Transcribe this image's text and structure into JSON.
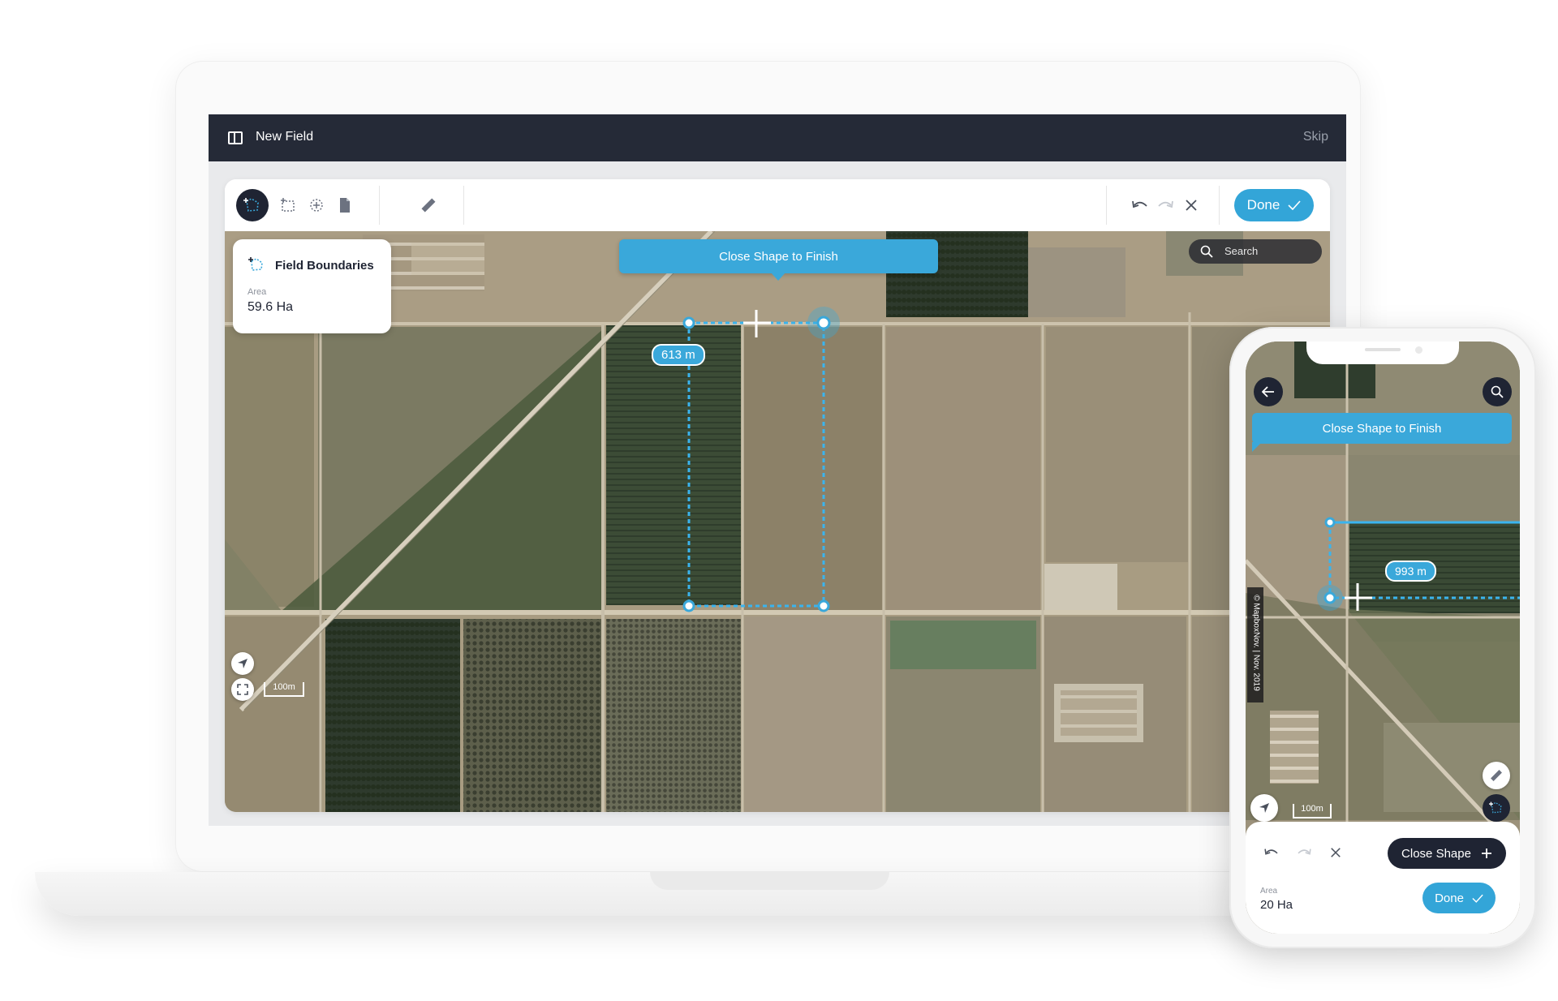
{
  "window": {
    "title": "New Field",
    "skip_label": "Skip"
  },
  "toolbar": {
    "done_label": "Done",
    "tools": [
      "draw-boundary-icon",
      "rectangle-select-icon",
      "add-point-icon",
      "document-icon",
      "ruler-icon"
    ],
    "actions": [
      "undo-icon",
      "redo-icon",
      "close-icon"
    ]
  },
  "field_panel": {
    "title": "Field Boundaries",
    "area_label": "Area",
    "area_value": "59.6 Ha"
  },
  "map": {
    "instruction": "Close Shape to Finish",
    "search_placeholder": "Search",
    "distance_label": "613 m",
    "scale_label": "100m"
  },
  "phone": {
    "instruction": "Close Shape to Finish",
    "distance_label": "993 m",
    "scale_label": "100m",
    "attribution": "© MapboxNov. | Nov. 2019",
    "close_shape_label": "Close Shape",
    "done_label": "Done",
    "area_label": "Area",
    "area_value": "20 Ha"
  },
  "colors": {
    "accent": "#33a5d8",
    "dark": "#1f2433",
    "titlebar": "#252a37"
  }
}
